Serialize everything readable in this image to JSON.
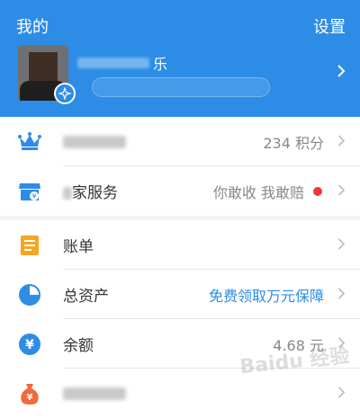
{
  "header": {
    "title": "我的",
    "settings_label": "设置",
    "user_name_visible": "乐",
    "colors": {
      "background": "#2d8ce6",
      "text": "#ffffff"
    }
  },
  "section1": {
    "items": [
      {
        "icon": "crown-icon",
        "label": "",
        "value": "234 积分",
        "icon_color": "#2d8ce6"
      },
      {
        "icon": "store-icon",
        "label": "家服务",
        "value": "你敢收 我敢赔",
        "has_red_dot": true,
        "icon_color": "#2d8ce6"
      }
    ]
  },
  "section2": {
    "items": [
      {
        "icon": "bill-icon",
        "label": "账单",
        "value": "",
        "icon_color": "#f5a623"
      },
      {
        "icon": "pie-chart-icon",
        "label": "总资产",
        "value": "免费领取万元保障",
        "value_color": "#2d8ce6",
        "icon_color": "#2d8ce6"
      },
      {
        "icon": "yen-coin-icon",
        "label": "余额",
        "value": "4.68 元",
        "icon_color": "#2d8ce6"
      },
      {
        "icon": "money-bag-icon",
        "label": "",
        "value": "",
        "icon_color": "#f06a3a"
      }
    ]
  },
  "watermark": "Baidu 经验"
}
